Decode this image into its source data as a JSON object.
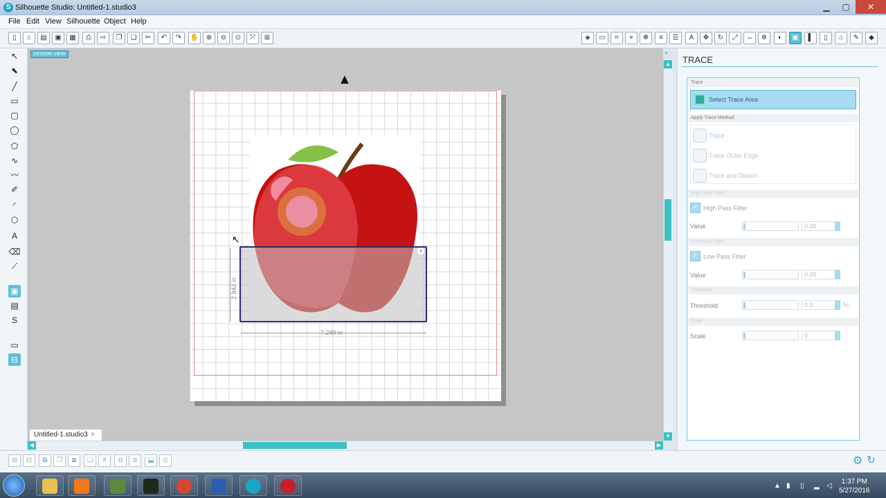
{
  "window": {
    "title": "Silhouette Studio: Untitled-1.studio3"
  },
  "menu": [
    "File",
    "Edit",
    "View",
    "Silhouette",
    "Object",
    "Help"
  ],
  "canvas": {
    "view_tag": "DESIGN VIEW",
    "width_label": "7.249 in",
    "height_label": "2.942 in"
  },
  "doc_tab": {
    "label": "Untitled-1.studio3",
    "close": "x"
  },
  "panel": {
    "title": "TRACE",
    "sec_trace": "Trace",
    "select_trace": "Select Trace Area",
    "sec_method": "Apply Trace Method",
    "methods": [
      "Trace",
      "Trace Outer Edge",
      "Trace and Detach"
    ],
    "sec_high": "High Pass Filter",
    "high_check": "High Pass Filter",
    "high_value_label": "Value",
    "high_value": "0.00",
    "sec_low": "Low Pass Filter",
    "low_check": "Low Pass Filter",
    "low_value_label": "Value",
    "low_value": "0.00",
    "sec_threshold": "Threshold",
    "threshold_label": "Threshold",
    "threshold_value": "0.0",
    "threshold_unit": "%",
    "sec_scale": "Scale",
    "scale_label": "Scale",
    "scale_value": "0"
  },
  "taskbar": {
    "time": "1:37 PM",
    "date": "5/27/2016"
  },
  "colors": {
    "accent": "#5ac0d8",
    "scroll": "#3cc0c4",
    "cut_border": "#e38a8a",
    "trace_rect": "#2b2b72"
  }
}
